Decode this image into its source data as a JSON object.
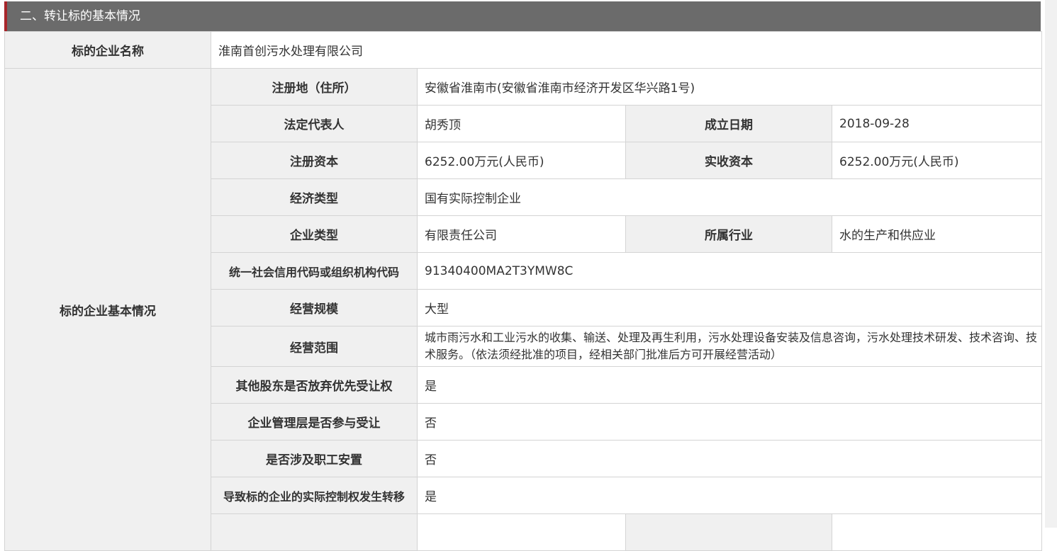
{
  "section": {
    "title": "二、转让标的基本情况"
  },
  "company_name": {
    "label": "标的企业名称",
    "value": "淮南首创污水处理有限公司"
  },
  "basic_info": {
    "group_label": "标的企业基本情况",
    "registered_address": {
      "label": "注册地（住所）",
      "value": "安徽省淮南市(安徽省淮南市经济开发区华兴路1号)"
    },
    "legal_rep": {
      "label": "法定代表人",
      "value": "胡秀顶"
    },
    "established_date": {
      "label": "成立日期",
      "value": "2018-09-28"
    },
    "registered_capital": {
      "label": "注册资本",
      "value": "6252.00万元(人民币)"
    },
    "paid_in_capital": {
      "label": "实收资本",
      "value": "6252.00万元(人民币)"
    },
    "economic_type": {
      "label": "经济类型",
      "value": "国有实际控制企业"
    },
    "enterprise_type": {
      "label": "企业类型",
      "value": "有限责任公司"
    },
    "industry": {
      "label": "所属行业",
      "value": "水的生产和供应业"
    },
    "credit_code": {
      "label": "统一社会信用代码或组织机构代码",
      "value": "91340400MA2T3YMW8C"
    },
    "scale": {
      "label": "经营规模",
      "value": "大型"
    },
    "business_scope": {
      "label": "经营范围",
      "value": "城市雨污水和工业污水的收集、输送、处理及再生利用，污水处理设备安装及信息咨询，污水处理技术研发、技术咨询、技术服务。（依法须经批准的项目，经相关部门批准后方可开展经营活动）"
    },
    "preemption_waived": {
      "label": "其他股东是否放弃优先受让权",
      "value": "是"
    },
    "mgmt_participation": {
      "label": "企业管理层是否参与受让",
      "value": "否"
    },
    "staff_placement": {
      "label": "是否涉及职工安置",
      "value": "否"
    },
    "control_transfer": {
      "label": "导致标的企业的实际控制权发生转移",
      "value": "是"
    }
  }
}
